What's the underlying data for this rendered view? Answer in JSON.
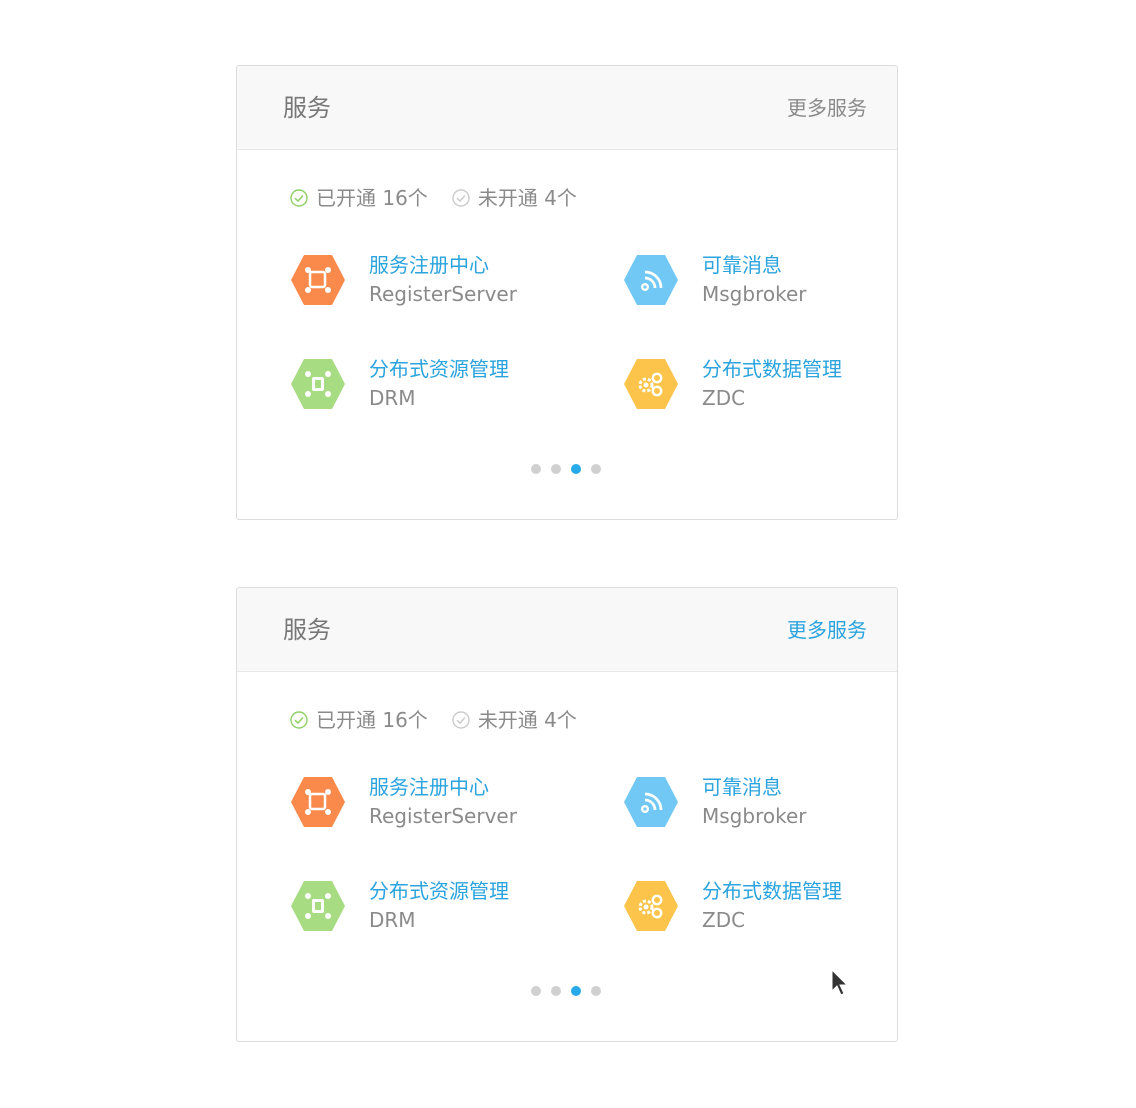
{
  "cards": [
    {
      "title": "服务",
      "more_label": "更多服务",
      "more_active": false,
      "status": {
        "opened": "已开通 16个",
        "unopened": "未开通 4个"
      },
      "services": [
        {
          "name": "服务注册中心",
          "code": "RegisterServer",
          "icon": "network-nodes-icon",
          "color": "#f98a4c"
        },
        {
          "name": "可靠消息",
          "code": "Msgbroker",
          "icon": "rss-gear-icon",
          "color": "#72c8f5"
        },
        {
          "name": "分布式资源管理",
          "code": "DRM",
          "icon": "resource-hub-icon",
          "color": "#a7dc83"
        },
        {
          "name": "分布式数据管理",
          "code": "ZDC",
          "icon": "gears-icon",
          "color": "#fcc44a"
        }
      ],
      "pagination": {
        "total": 4,
        "active_index": 2
      }
    },
    {
      "title": "服务",
      "more_label": "更多服务",
      "more_active": true,
      "status": {
        "opened": "已开通 16个",
        "unopened": "未开通 4个"
      },
      "services": [
        {
          "name": "服务注册中心",
          "code": "RegisterServer",
          "icon": "network-nodes-icon",
          "color": "#f98a4c"
        },
        {
          "name": "可靠消息",
          "code": "Msgbroker",
          "icon": "rss-gear-icon",
          "color": "#72c8f5"
        },
        {
          "name": "分布式资源管理",
          "code": "DRM",
          "icon": "resource-hub-icon",
          "color": "#a7dc83"
        },
        {
          "name": "分布式数据管理",
          "code": "ZDC",
          "icon": "gears-icon",
          "color": "#fcc44a"
        }
      ],
      "pagination": {
        "total": 4,
        "active_index": 2
      }
    }
  ],
  "colors": {
    "link_active": "#2aa3de",
    "opened_check": "#8fd068",
    "unopened_check": "#cccccc",
    "dot_active": "#27aae7",
    "dot_inactive": "#d0d0d0"
  }
}
